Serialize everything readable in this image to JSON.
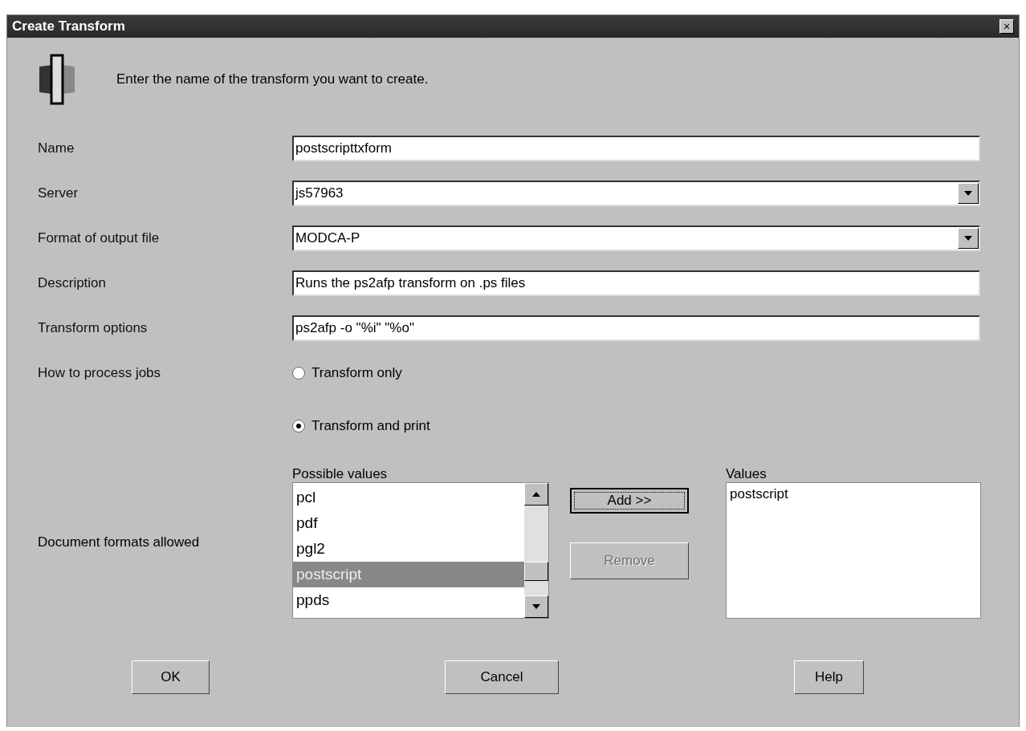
{
  "window": {
    "title": "Create Transform",
    "close": "×"
  },
  "intro": "Enter the name of the transform you want to create.",
  "fields": [
    {
      "kind": "text",
      "label": "Name",
      "value": "postscripttxform"
    },
    {
      "kind": "select",
      "label": "Server",
      "value": "js57963"
    },
    {
      "kind": "select",
      "label": "Format of output file",
      "value": "MODCA-P"
    },
    {
      "kind": "text",
      "label": "Description",
      "value": "Runs the ps2afp transform on .ps files"
    },
    {
      "kind": "text",
      "label": "Transform options",
      "value": "ps2afp -o \"%i\" \"%o\""
    }
  ],
  "process_jobs": {
    "label": "How to process jobs",
    "options": [
      {
        "label": "Transform only",
        "selected": false
      },
      {
        "label": "Transform and print",
        "selected": true
      }
    ]
  },
  "document_formats": {
    "label": "Document formats allowed",
    "possible_label": "Possible values",
    "possible_values": [
      {
        "label": "pcl",
        "selected": false
      },
      {
        "label": "pdf",
        "selected": false
      },
      {
        "label": "pgl2",
        "selected": false
      },
      {
        "label": "postscript",
        "selected": true
      },
      {
        "label": "ppds",
        "selected": false
      }
    ],
    "add": {
      "label": "Add >>",
      "focused": true,
      "disabled": false
    },
    "remove": {
      "label": "Remove",
      "focused": false,
      "disabled": true
    },
    "values_label": "Values",
    "values": [
      "postscript"
    ]
  },
  "buttons": [
    "OK",
    "Cancel",
    "Help"
  ]
}
